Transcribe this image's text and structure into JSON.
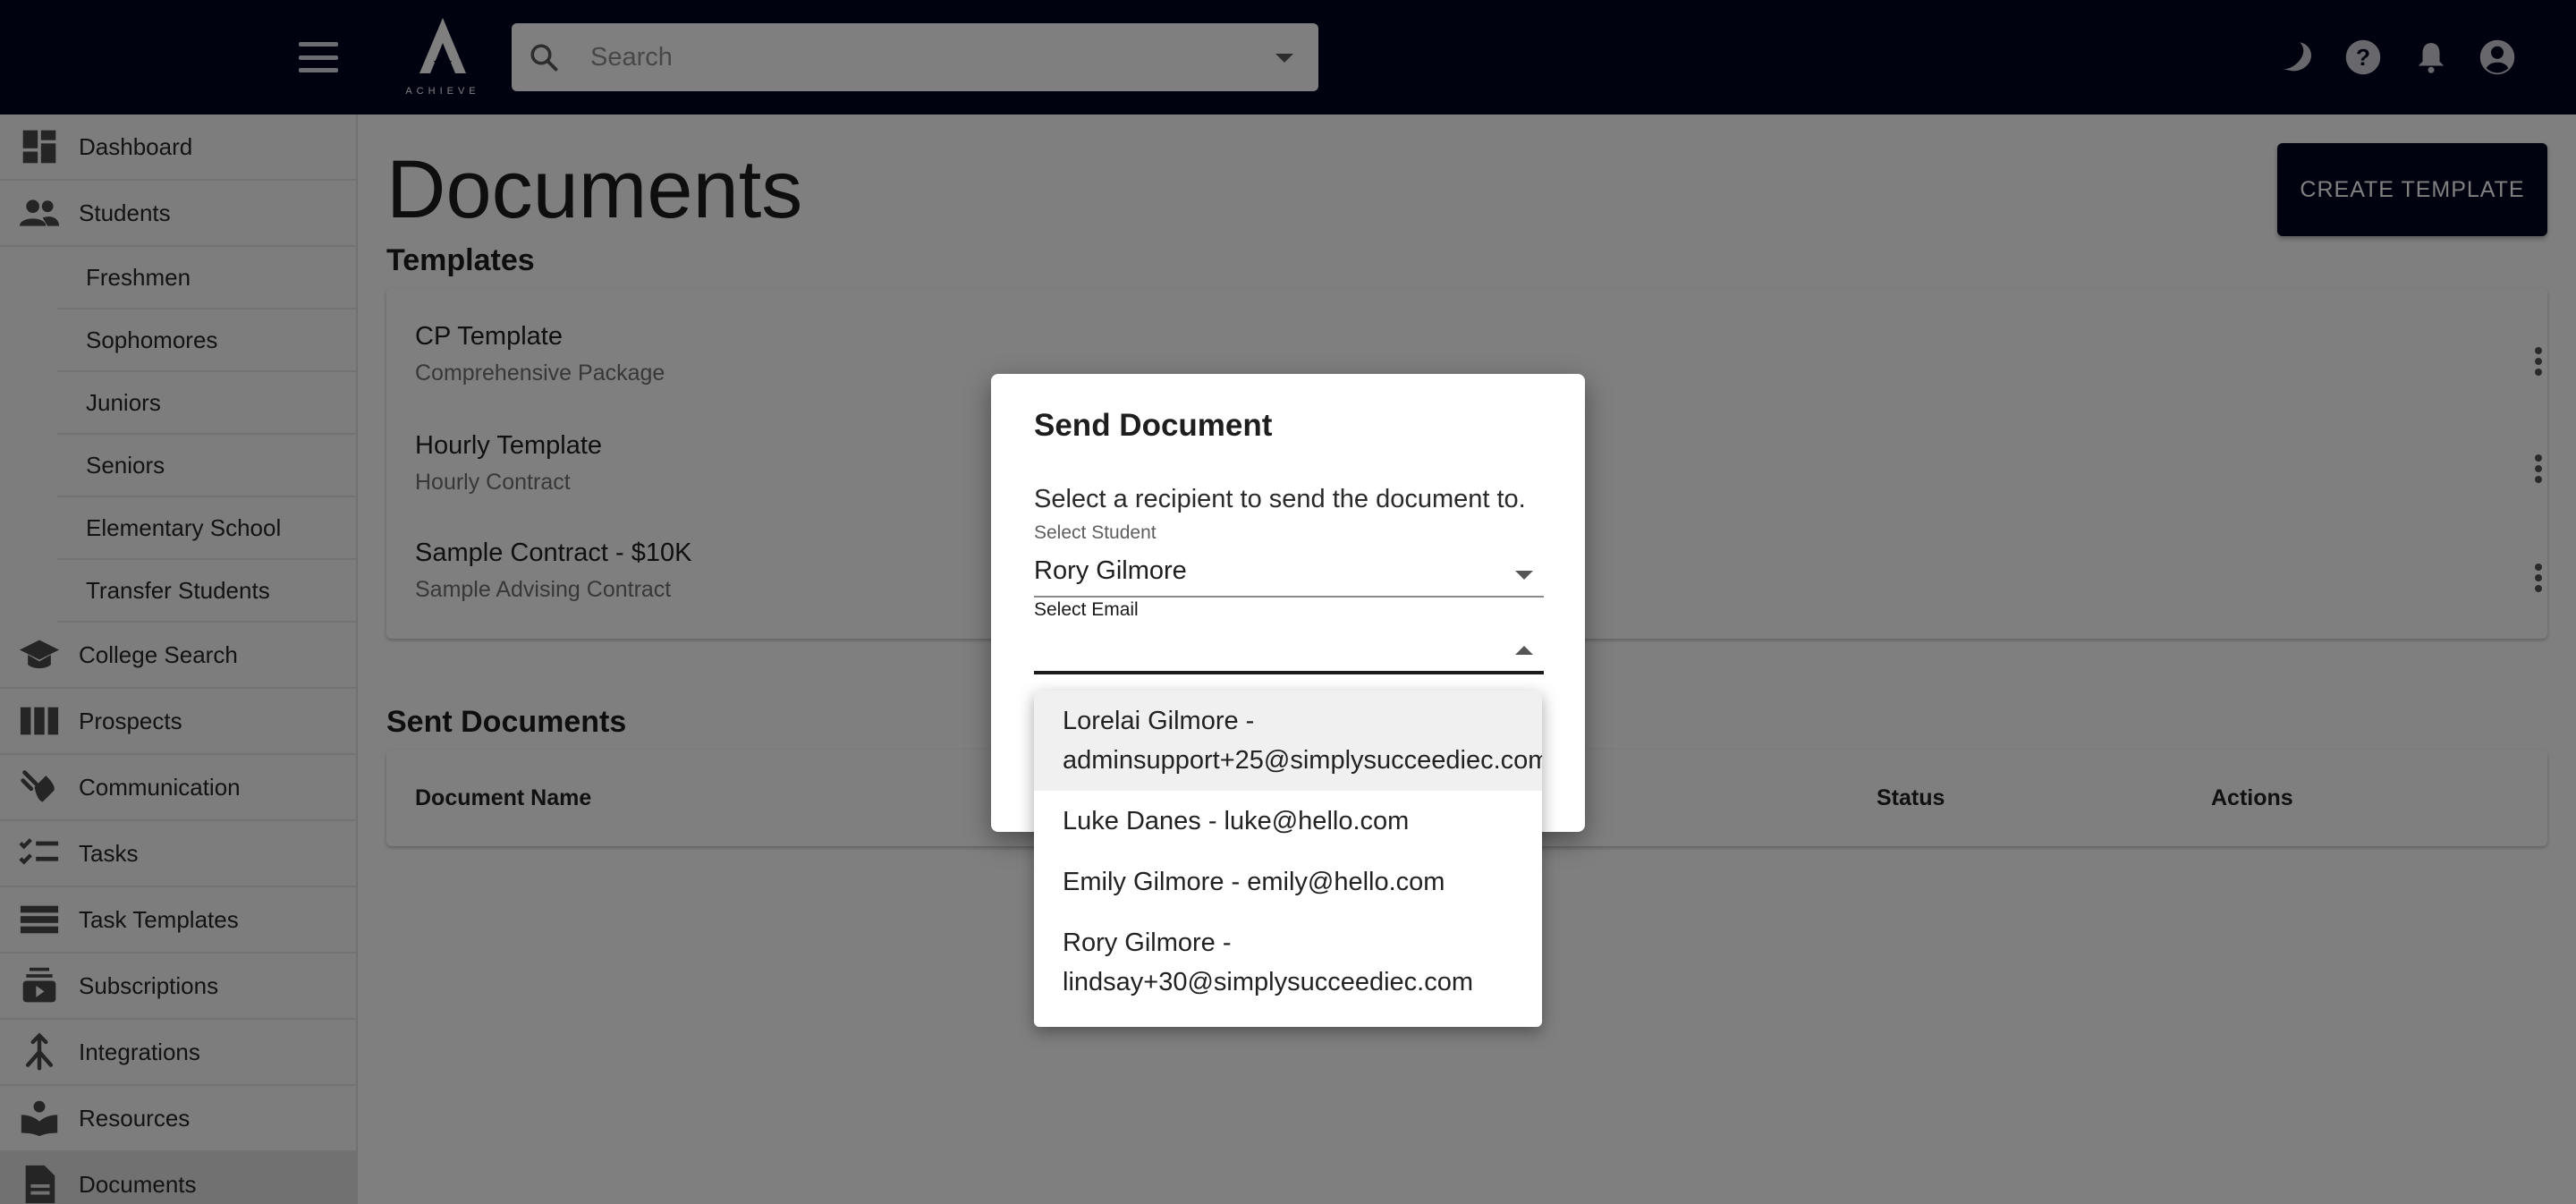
{
  "header": {
    "brand": "ACHIEVE",
    "search_placeholder": "Search"
  },
  "sidebar": {
    "items": [
      {
        "label": "Dashboard",
        "icon": "dashboard-icon"
      },
      {
        "label": "Students",
        "icon": "students-icon"
      },
      {
        "label": "College Search",
        "icon": "graduation-cap-icon"
      },
      {
        "label": "Prospects",
        "icon": "columns-icon"
      },
      {
        "label": "Communication",
        "icon": "communication-icon"
      },
      {
        "label": "Tasks",
        "icon": "checklist-icon"
      },
      {
        "label": "Task Templates",
        "icon": "list-icon"
      },
      {
        "label": "Subscriptions",
        "icon": "subscriptions-icon"
      },
      {
        "label": "Integrations",
        "icon": "merge-icon"
      },
      {
        "label": "Resources",
        "icon": "book-icon"
      },
      {
        "label": "Documents",
        "icon": "document-icon"
      }
    ],
    "student_subitems": [
      "Freshmen",
      "Sophomores",
      "Juniors",
      "Seniors",
      "Elementary School",
      "Transfer Students"
    ],
    "active": "Documents"
  },
  "main": {
    "title": "Documents",
    "create_button": "CREATE TEMPLATE",
    "templates_title": "Templates",
    "templates": [
      {
        "name": "CP Template",
        "description": "Comprehensive Package"
      },
      {
        "name": "Hourly Template",
        "description": "Hourly Contract"
      },
      {
        "name": "Sample Contract - $10K",
        "description": "Sample Advising Contract"
      }
    ],
    "sent_title": "Sent Documents",
    "sent_columns": [
      "Document Name",
      "Status",
      "Actions"
    ]
  },
  "dialog": {
    "title": "Send Document",
    "description": "Select a recipient to send the document to.",
    "student_label": "Select Student",
    "student_value": "Rory Gilmore",
    "email_label": "Select Email",
    "email_value": ""
  },
  "email_options": [
    {
      "line1": "Lorelai Gilmore -",
      "line2": "adminsupport+25@simplysucceediec.com",
      "highlighted": true
    },
    {
      "line1": "Luke Danes - luke@hello.com",
      "line2": "",
      "highlighted": false
    },
    {
      "line1": "Emily Gilmore - emily@hello.com",
      "line2": "",
      "highlighted": false
    },
    {
      "line1": "Rory Gilmore -",
      "line2": "lindsay+30@simplysucceediec.com",
      "highlighted": false
    }
  ],
  "colors": {
    "topbar": "#030521",
    "accent": "#030521",
    "overlay": "rgba(0,0,0,0.5)"
  }
}
